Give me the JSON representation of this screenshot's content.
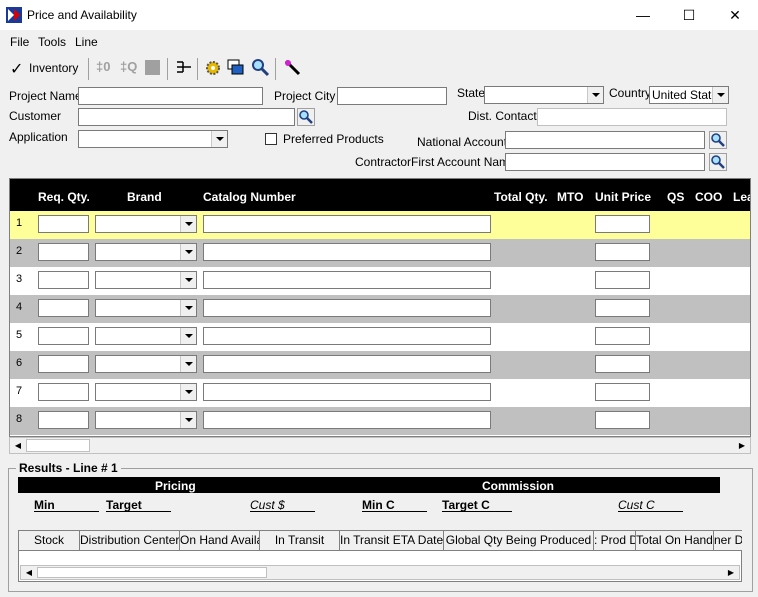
{
  "window": {
    "title": "Price and Availability",
    "minimize": "—",
    "maximize": "☐",
    "close": "✕"
  },
  "menu": {
    "file": "File",
    "tools": "Tools",
    "line": "Line"
  },
  "toolbar": {
    "inventory": "Inventory"
  },
  "form": {
    "project_name": "Project Name",
    "project_city": "Project City",
    "state": "State",
    "country": "Country",
    "country_value": "United State",
    "customer": "Customer",
    "dist_contact": "Dist. Contact",
    "application": "Application",
    "preferred_products": "Preferred Products",
    "national_account": "National Account",
    "contractor_first": "ContractorFirst Account Name"
  },
  "grid": {
    "headers": {
      "req_qty": "Req. Qty.",
      "brand": "Brand",
      "catalog": "Catalog Number",
      "total_qty": "Total Qty.",
      "mto": "MTO",
      "unit_price": "Unit Price",
      "qs": "QS",
      "coo": "COO",
      "lead": "Lea"
    },
    "rows": [
      "1",
      "2",
      "3",
      "4",
      "5",
      "6",
      "7",
      "8"
    ]
  },
  "results": {
    "title": "Results - Line # 1",
    "pricing": "Pricing",
    "commission": "Commission",
    "min": "Min",
    "target": "Target",
    "cust_s": "Cust $",
    "min_c": "Min C",
    "target_c": "Target C",
    "cust_c": "Cust C",
    "stock_cols": [
      "Stock",
      "Distribution Center",
      "On Hand Availa",
      "In Transit",
      "In Transit ETA Date",
      "Global Qty Being Produced",
      ": Prod D",
      "Total On Hand",
      "ner D"
    ]
  },
  "colors": {
    "selected_row": "#ffff99",
    "alt_row": "#c0c0c0",
    "header": "#000000"
  }
}
